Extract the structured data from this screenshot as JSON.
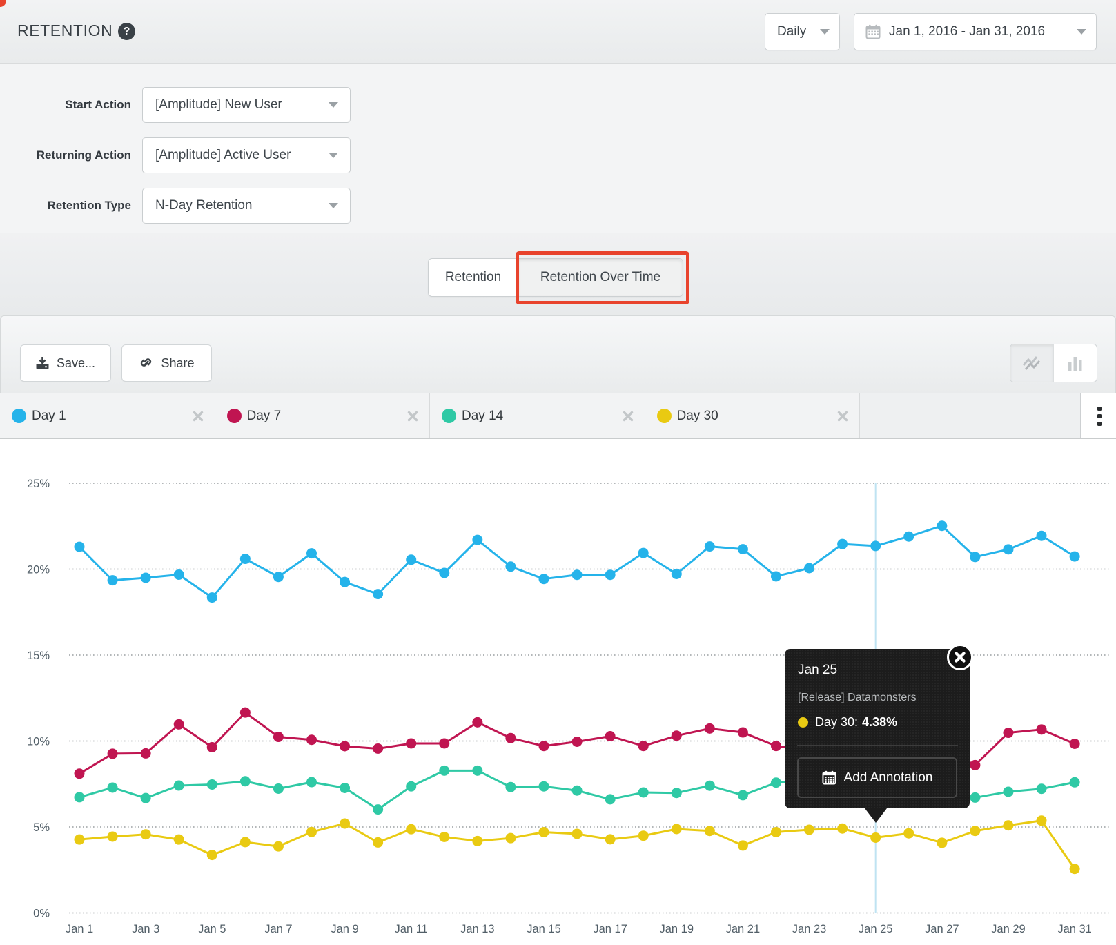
{
  "header": {
    "title": "RETENTION",
    "help_icon": "?",
    "granularity": {
      "value": "Daily"
    },
    "date_range": {
      "value": "Jan 1, 2016 - Jan 31, 2016"
    }
  },
  "form": {
    "rows": [
      {
        "label": "Start Action",
        "value": "[Amplitude] New User"
      },
      {
        "label": "Returning Action",
        "value": "[Amplitude] Active User"
      },
      {
        "label": "Retention Type",
        "value": "N-Day Retention"
      }
    ]
  },
  "view_tabs": {
    "items": [
      {
        "label": "Retention",
        "active": false
      },
      {
        "label": "Retention Over Time",
        "active": true
      }
    ],
    "highlight_color": "#e8432d"
  },
  "toolbar": {
    "save_label": "Save...",
    "share_label": "Share",
    "chart_type_toggle": [
      {
        "icon": "line-chart-icon",
        "active": true
      },
      {
        "icon": "bar-chart-icon",
        "active": false
      }
    ]
  },
  "legend": {
    "items": [
      {
        "label": "Day 1",
        "color": "#25b3ea"
      },
      {
        "label": "Day 7",
        "color": "#c01551"
      },
      {
        "label": "Day 14",
        "color": "#2fc9a5"
      },
      {
        "label": "Day 30",
        "color": "#e9ca12"
      }
    ],
    "close_icon": "x",
    "overflow_icon": "kebab-menu"
  },
  "tooltip": {
    "date": "Jan 25",
    "annotation_title": "[Release] Datamonsters",
    "series_label": "Day 30:",
    "series_value": "4.38%",
    "series_color": "#e9ca12",
    "button_label": "Add Annotation",
    "close_icon": "x"
  },
  "chart_data": {
    "type": "line",
    "categories": [
      "Jan 1",
      "Jan 2",
      "Jan 3",
      "Jan 4",
      "Jan 5",
      "Jan 6",
      "Jan 7",
      "Jan 8",
      "Jan 9",
      "Jan 10",
      "Jan 11",
      "Jan 12",
      "Jan 13",
      "Jan 14",
      "Jan 15",
      "Jan 16",
      "Jan 17",
      "Jan 18",
      "Jan 19",
      "Jan 20",
      "Jan 21",
      "Jan 22",
      "Jan 23",
      "Jan 24",
      "Jan 25",
      "Jan 26",
      "Jan 27",
      "Jan 28",
      "Jan 29",
      "Jan 30",
      "Jan 31"
    ],
    "x_tick_labels": [
      "Jan 1",
      "Jan 3",
      "Jan 5",
      "Jan 7",
      "Jan 9",
      "Jan 11",
      "Jan 13",
      "Jan 15",
      "Jan 17",
      "Jan 19",
      "Jan 21",
      "Jan 23",
      "Jan 25",
      "Jan 27",
      "Jan 29",
      "Jan 31"
    ],
    "y_tick_labels": [
      "0%",
      "5%",
      "10%",
      "15%",
      "20%",
      "25%"
    ],
    "y_tick_values": [
      0,
      5,
      10,
      15,
      20,
      25
    ],
    "ylim": [
      0,
      25
    ],
    "grid": "dotted-horizontal",
    "legend_position": "top-tabs",
    "annotation_line": {
      "x": "Jan 25",
      "color": "#bfe3f2"
    },
    "series": [
      {
        "name": "Day 1",
        "color": "#25b3ea",
        "values": [
          21.3,
          19.35,
          19.5,
          19.68,
          18.35,
          20.6,
          19.55,
          20.92,
          19.25,
          18.55,
          20.55,
          19.78,
          21.7,
          20.15,
          19.43,
          19.67,
          19.67,
          20.94,
          19.72,
          21.32,
          21.16,
          19.58,
          20.06,
          21.46,
          21.35,
          21.9,
          22.52,
          20.71,
          21.15,
          21.94,
          20.74
        ]
      },
      {
        "name": "Day 7",
        "color": "#c01551",
        "values": [
          8.1,
          9.26,
          9.28,
          10.97,
          9.64,
          11.66,
          10.24,
          10.07,
          9.7,
          9.56,
          9.86,
          9.86,
          11.09,
          10.17,
          9.71,
          9.96,
          10.28,
          9.71,
          10.31,
          10.73,
          10.5,
          9.71,
          9.5,
          10.4,
          10.1,
          10.5,
          9.6,
          8.6,
          10.48,
          10.67,
          9.84
        ]
      },
      {
        "name": "Day 14",
        "color": "#2fc9a5",
        "values": [
          6.73,
          7.29,
          6.68,
          7.41,
          7.47,
          7.66,
          7.23,
          7.61,
          7.27,
          6.02,
          7.36,
          8.28,
          8.28,
          7.32,
          7.36,
          7.12,
          6.61,
          7.01,
          6.98,
          7.4,
          6.85,
          7.58,
          7.7,
          7.5,
          7.3,
          7.1,
          6.5,
          6.71,
          7.05,
          7.22,
          7.6
        ]
      },
      {
        "name": "Day 30",
        "color": "#e9ca12",
        "values": [
          4.27,
          4.44,
          4.57,
          4.27,
          3.37,
          4.12,
          3.87,
          4.71,
          5.2,
          4.1,
          4.87,
          4.42,
          4.18,
          4.35,
          4.7,
          4.6,
          4.28,
          4.49,
          4.88,
          4.77,
          3.92,
          4.7,
          4.84,
          4.91,
          4.38,
          4.63,
          4.08,
          4.77,
          5.09,
          5.37,
          2.56
        ]
      }
    ]
  }
}
